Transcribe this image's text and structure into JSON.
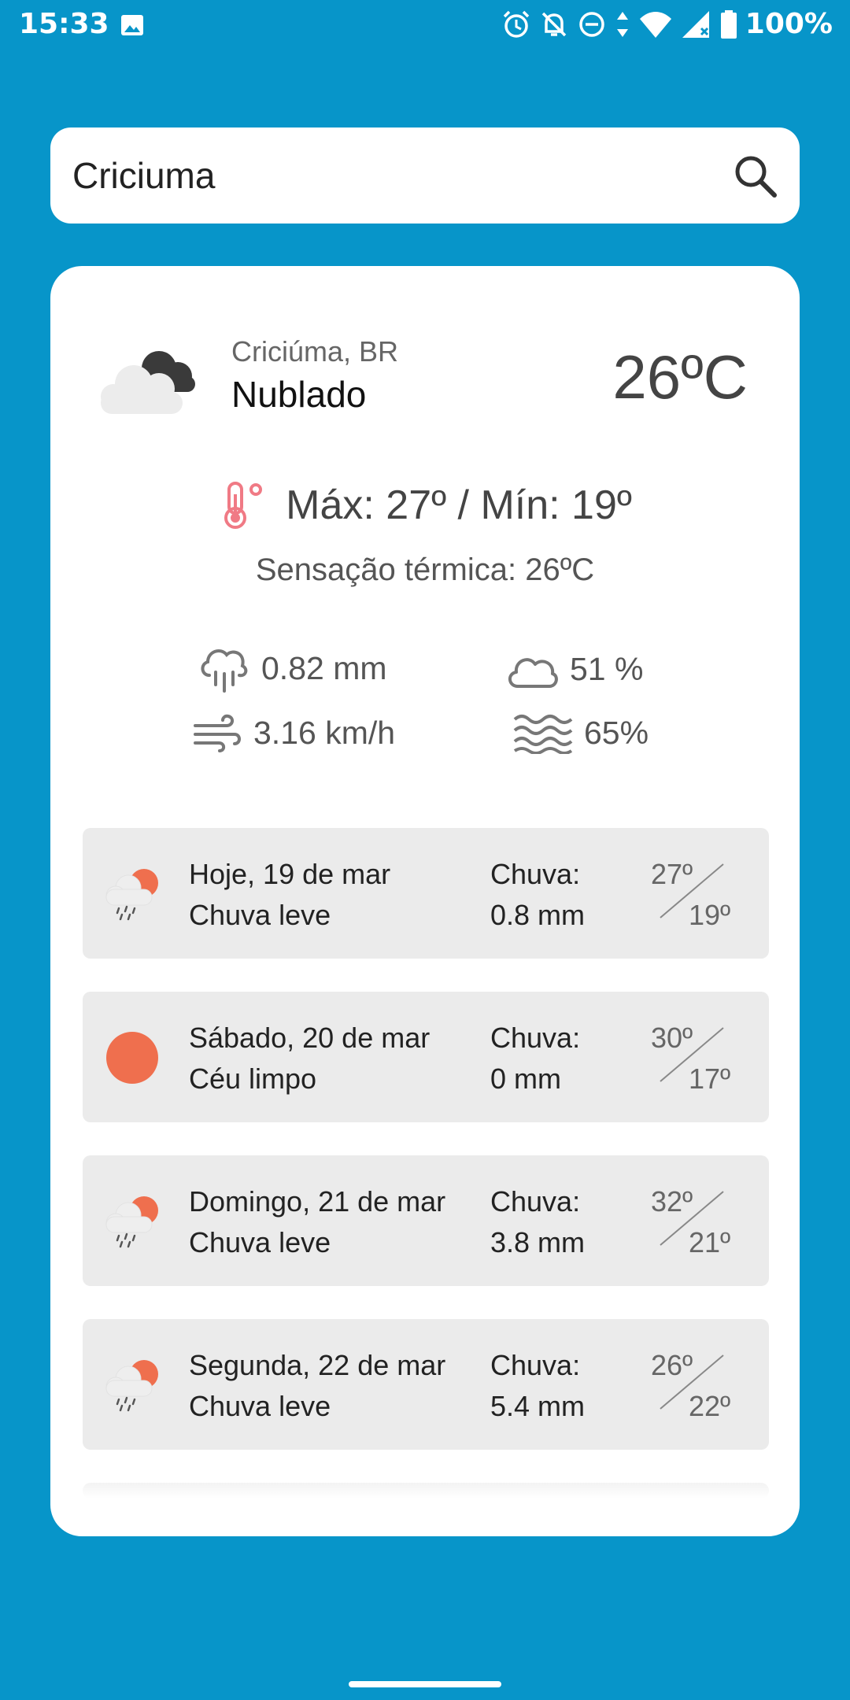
{
  "status_bar": {
    "time": "15:33",
    "battery": "100%",
    "icons": [
      "image-icon",
      "alarm-icon",
      "bell-off-icon",
      "dnd-icon",
      "data-arrows-icon",
      "wifi-icon",
      "signal-icon",
      "battery-icon"
    ]
  },
  "search": {
    "value": "Criciuma",
    "icon": "search-icon"
  },
  "current": {
    "city": "Criciúma, BR",
    "description": "Nublado",
    "temperature": "26ºC",
    "icon": "cloudy-icon",
    "minmax": "Máx: 27º / Mín: 19º",
    "feels_like": "Sensação térmica: 26ºC",
    "rain": "0.82 mm",
    "clouds": "51 %",
    "wind": "3.16 km/h",
    "humidity": "65%"
  },
  "forecast": [
    {
      "date": "Hoje, 19 de mar",
      "condition": "Chuva leve",
      "rain_label": "Chuva:",
      "rain": "0.8 mm",
      "max": "27º",
      "min": "19º",
      "icon": "light-rain-icon"
    },
    {
      "date": "Sábado, 20 de mar",
      "condition": "Céu limpo",
      "rain_label": "Chuva:",
      "rain": "0 mm",
      "max": "30º",
      "min": "17º",
      "icon": "clear-sky-icon"
    },
    {
      "date": "Domingo, 21 de mar",
      "condition": "Chuva leve",
      "rain_label": "Chuva:",
      "rain": "3.8 mm",
      "max": "32º",
      "min": "21º",
      "icon": "light-rain-icon"
    },
    {
      "date": "Segunda, 22 de mar",
      "condition": "Chuva leve",
      "rain_label": "Chuva:",
      "rain": "5.4 mm",
      "max": "26º",
      "min": "22º",
      "icon": "light-rain-icon"
    }
  ],
  "colors": {
    "background": "#0795c9",
    "card": "#ffffff",
    "forecast_card": "#ebebeb",
    "sun": "#ef6f4e",
    "thermometer": "#f07a85"
  }
}
